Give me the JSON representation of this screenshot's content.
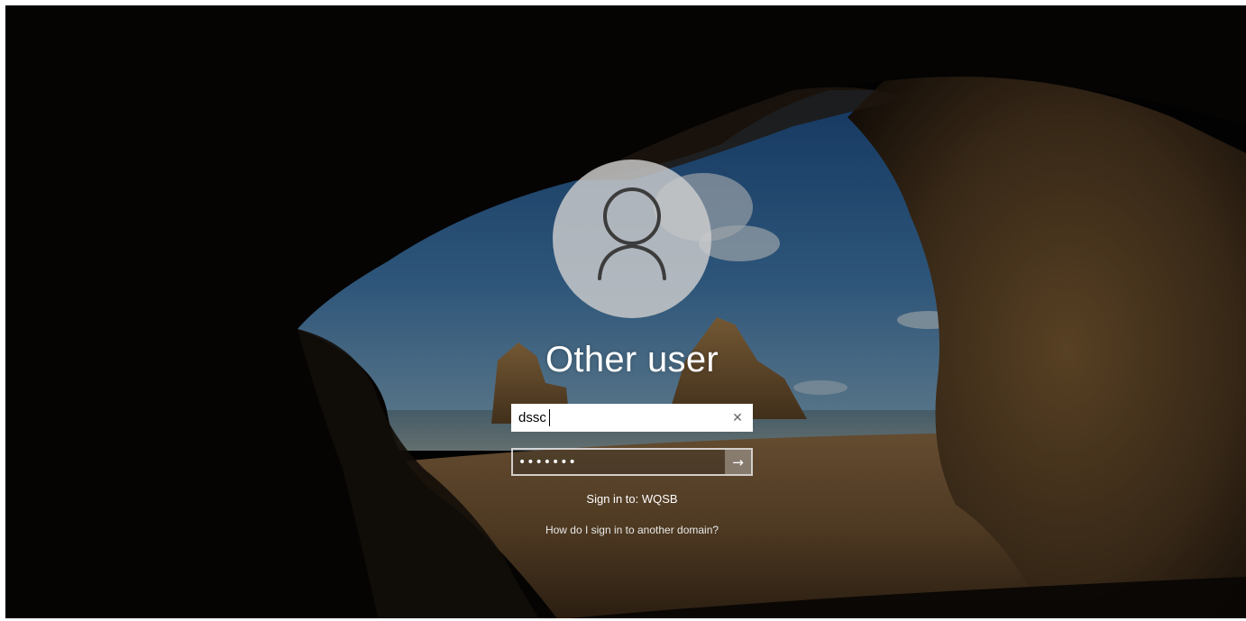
{
  "user": {
    "name": "Other user"
  },
  "username_field": {
    "value": "dssc"
  },
  "password_field": {
    "masked_value": "•••••••"
  },
  "sign_in_to": {
    "text": "Sign in to: WQSB"
  },
  "domain_help_link": {
    "text": "How do I sign in to another domain?"
  },
  "icons": {
    "avatar": "person-outline-icon",
    "clear": "close-icon",
    "submit": "arrow-right-icon"
  },
  "colors": {
    "text": "#ffffff",
    "avatar_bg": "#cdcdcd",
    "field_bg": "#ffffff"
  }
}
